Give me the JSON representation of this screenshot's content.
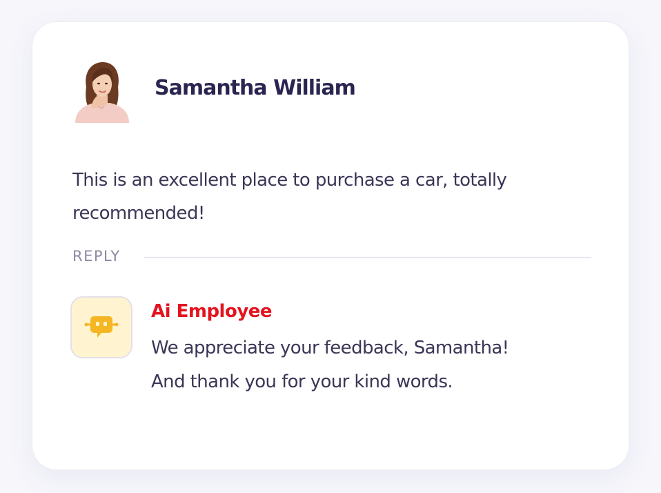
{
  "review": {
    "author_name": "Samantha William",
    "avatar_icon": "woman-portrait-avatar",
    "text": "This is an excellent place to purchase a car, totally recommended!"
  },
  "reply": {
    "section_label": "REPLY",
    "author_name": "Ai Employee",
    "author_color": "#e3141f",
    "avatar_icon": "robot-chat-icon",
    "avatar_bg": "#fff4cf",
    "icon_color": "#f5b623",
    "lines": [
      "We appreciate your feedback, Samantha!",
      "And thank you for your kind words."
    ]
  },
  "colors": {
    "name": "#2a2550",
    "body_text": "#3a3656",
    "muted": "#8a8aa3"
  }
}
